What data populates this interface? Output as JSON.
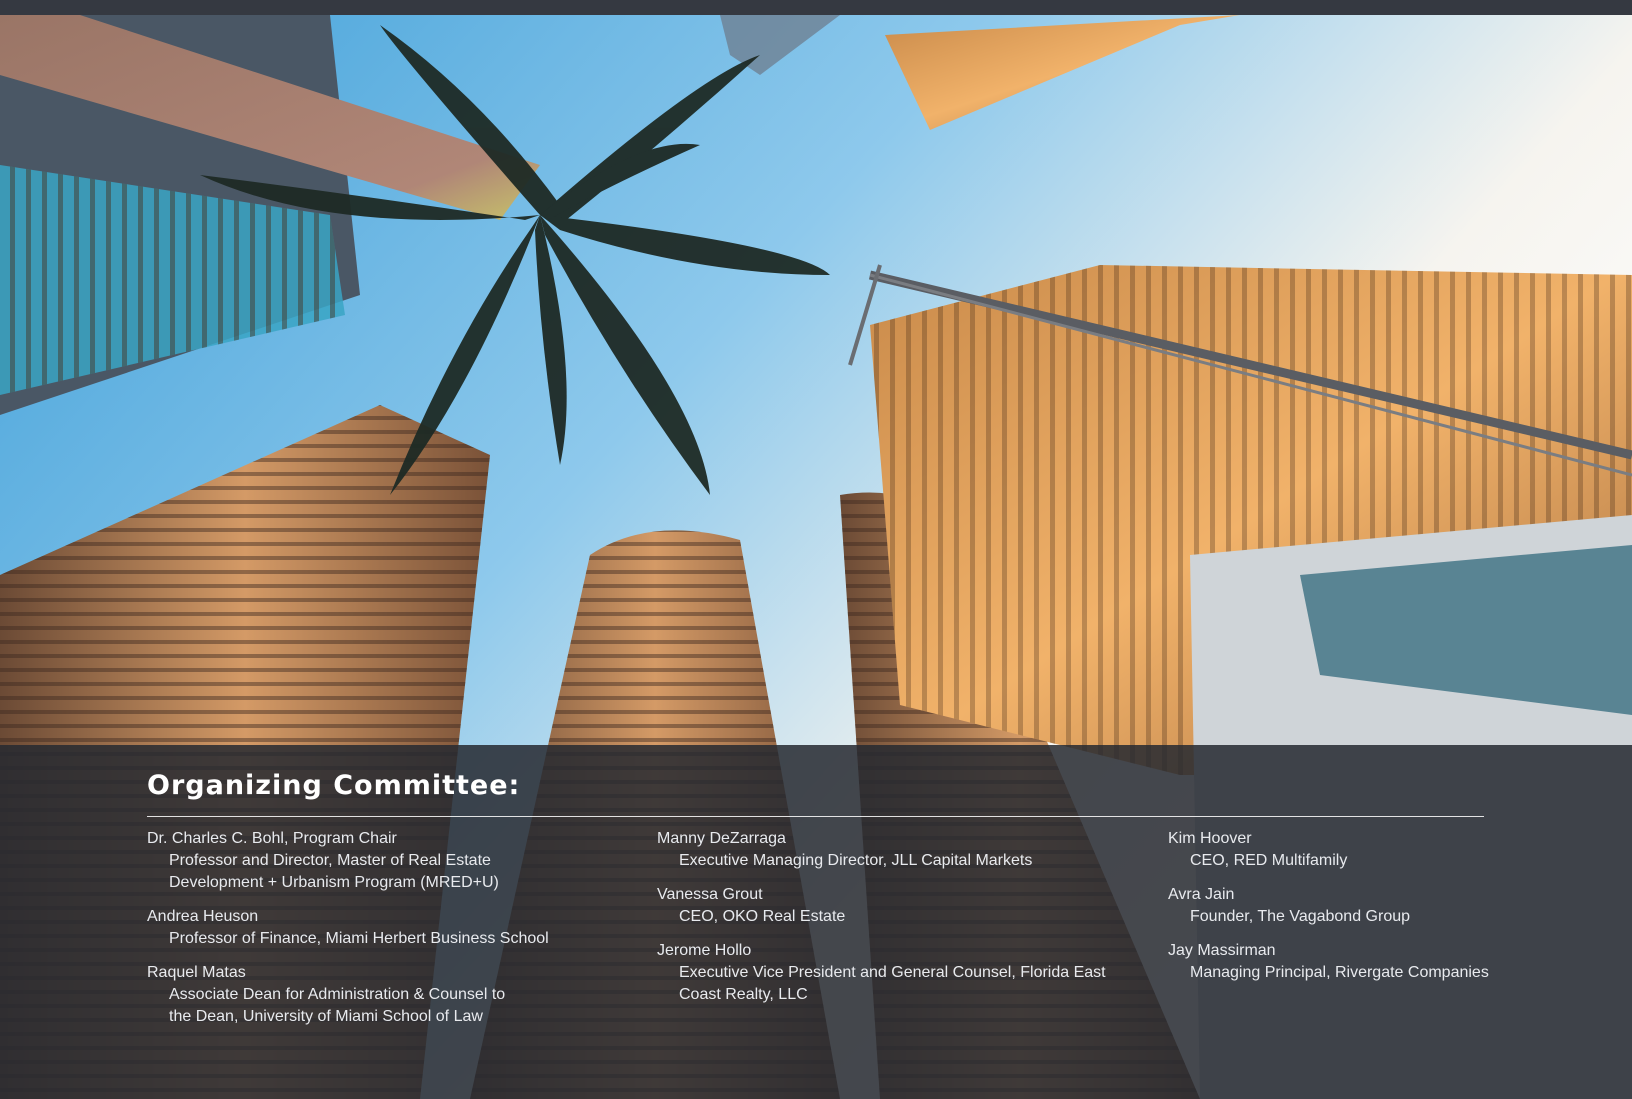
{
  "section": {
    "heading": "Organizing Committee:"
  },
  "columns": [
    {
      "members": [
        {
          "name": "Dr. Charles C. Bohl, Program Chair",
          "role_lines": [
            "Professor and Director, Master of Real Estate",
            "Development + Urbanism Program (MRED+U)"
          ]
        },
        {
          "name": "Andrea Heuson",
          "role_lines": [
            "Professor of Finance, Miami Herbert Business School"
          ]
        },
        {
          "name": "Raquel Matas",
          "role_lines": [
            "Associate Dean for Administration & Counsel to",
            "the Dean, University of Miami School of Law"
          ]
        }
      ]
    },
    {
      "members": [
        {
          "name": "Manny DeZarraga",
          "role_lines": [
            "Executive Managing Director, JLL Capital Markets"
          ]
        },
        {
          "name": "Vanessa Grout",
          "role_lines": [
            "CEO, OKO Real Estate"
          ]
        },
        {
          "name": "Jerome Hollo",
          "role_lines": [
            "Executive Vice President and General Counsel, Florida East",
            "Coast Realty, LLC"
          ]
        }
      ]
    },
    {
      "members": [
        {
          "name": "Kim Hoover",
          "role_lines": [
            "CEO, RED Multifamily"
          ]
        },
        {
          "name": "Avra Jain",
          "role_lines": [
            "Founder, The Vagabond Group"
          ]
        },
        {
          "name": "Jay Massirman",
          "role_lines": [
            "Managing Principal, Rivergate Companies"
          ]
        }
      ]
    }
  ],
  "theme": {
    "overlay": "#262a31",
    "text": "#e8eaee",
    "heading": "#ffffff"
  }
}
